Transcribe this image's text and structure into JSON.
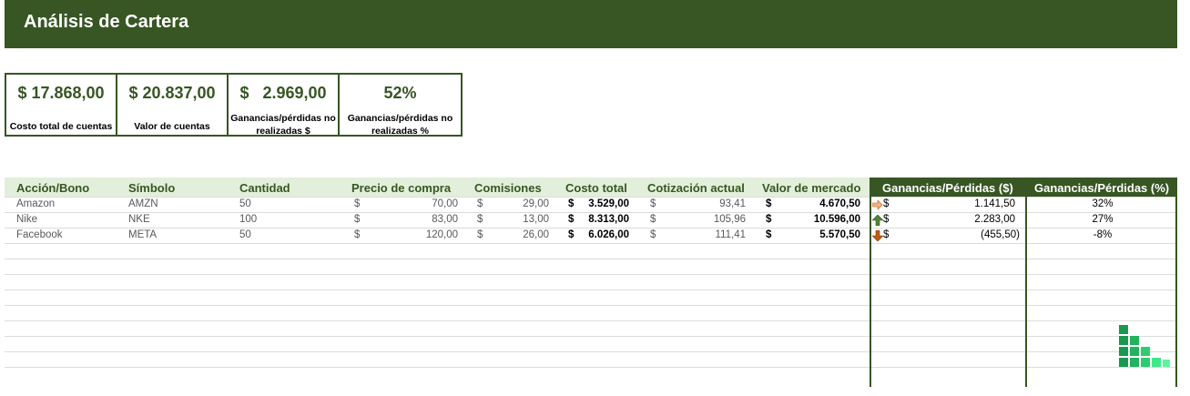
{
  "header": {
    "title": "Análisis de Cartera"
  },
  "summary": [
    {
      "value": "$ 17.868,00",
      "label": "Costo total de cuentas"
    },
    {
      "value": "$ 20.837,00",
      "label": "Valor de cuentas"
    },
    {
      "value": "$   2.969,00",
      "label": "Ganancias/pérdidas no realizadas $"
    },
    {
      "value": "52%",
      "label": "Ganancias/pérdidas no realizadas %"
    }
  ],
  "table": {
    "headers": [
      "Acción/Bono",
      "Símbolo",
      "Cantidad",
      "Precio de compra",
      "Comisiones",
      "Costo total",
      "Cotización actual",
      "Valor de mercado",
      "Ganancias/Pérdidas ($)",
      "Ganancias/Pérdidas (%)"
    ],
    "currency_symbol": "$",
    "rows": [
      {
        "name": "Amazon",
        "symbol": "AMZN",
        "qty": "50",
        "price": "70,00",
        "fees": "29,00",
        "cost": "3.529,00",
        "quote": "93,41",
        "market": "4.670,50",
        "trend": "arrow-right-icon",
        "gain": "1.141,50",
        "pct": "32%"
      },
      {
        "name": "Nike",
        "symbol": "NKE",
        "qty": "100",
        "price": "83,00",
        "fees": "13,00",
        "cost": "8.313,00",
        "quote": "105,96",
        "market": "10.596,00",
        "trend": "arrow-up-icon",
        "gain": "2.283,00",
        "pct": "27%"
      },
      {
        "name": "Facebook",
        "symbol": "META",
        "qty": "50",
        "price": "120,00",
        "fees": "26,00",
        "cost": "6.026,00",
        "quote": "111,41",
        "market": "5.570,50",
        "trend": "arrow-down-icon",
        "gain": "(455,50)",
        "pct": "-8%"
      }
    ]
  },
  "colors": {
    "header_bg": "#375623",
    "table_header_bg": "#e2efda",
    "arrow_right": "#f4b183",
    "arrow_up": "#548235",
    "arrow_down": "#c65911",
    "logo_green": "#2e8b57"
  }
}
